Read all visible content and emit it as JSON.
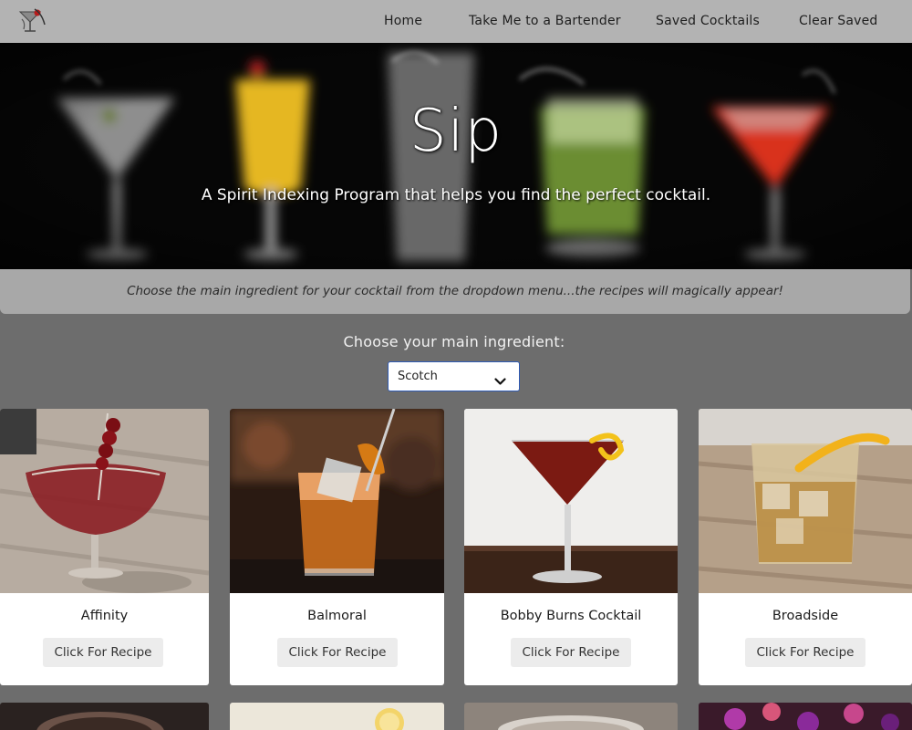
{
  "nav": {
    "links": [
      "Home",
      "Take Me to a Bartender",
      "Saved Cocktails",
      "Clear Saved"
    ]
  },
  "hero": {
    "title": "Sip",
    "tagline": "A Spirit Indexing Program that helps you find the perfect cocktail."
  },
  "info": {
    "text": "Choose the main ingredient for your cocktail from the dropdown menu...the recipes will magically appear!"
  },
  "selector": {
    "label": "Choose your main ingredient:",
    "value": "Scotch"
  },
  "cards": [
    {
      "name": "Affinity",
      "button": "Click For Recipe"
    },
    {
      "name": "Balmoral",
      "button": "Click For Recipe"
    },
    {
      "name": "Bobby Burns Cocktail",
      "button": "Click For Recipe"
    },
    {
      "name": "Broadside",
      "button": "Click For Recipe"
    }
  ],
  "colors": {
    "navbar": "#b3b3b3",
    "page_bg": "#6d6d6d",
    "info_bar": "#a8a8a8",
    "select_border": "#2f5bb5"
  },
  "icons": {
    "logo": "cocktail-logo-icon",
    "dropdown": "chevron-down-icon"
  }
}
